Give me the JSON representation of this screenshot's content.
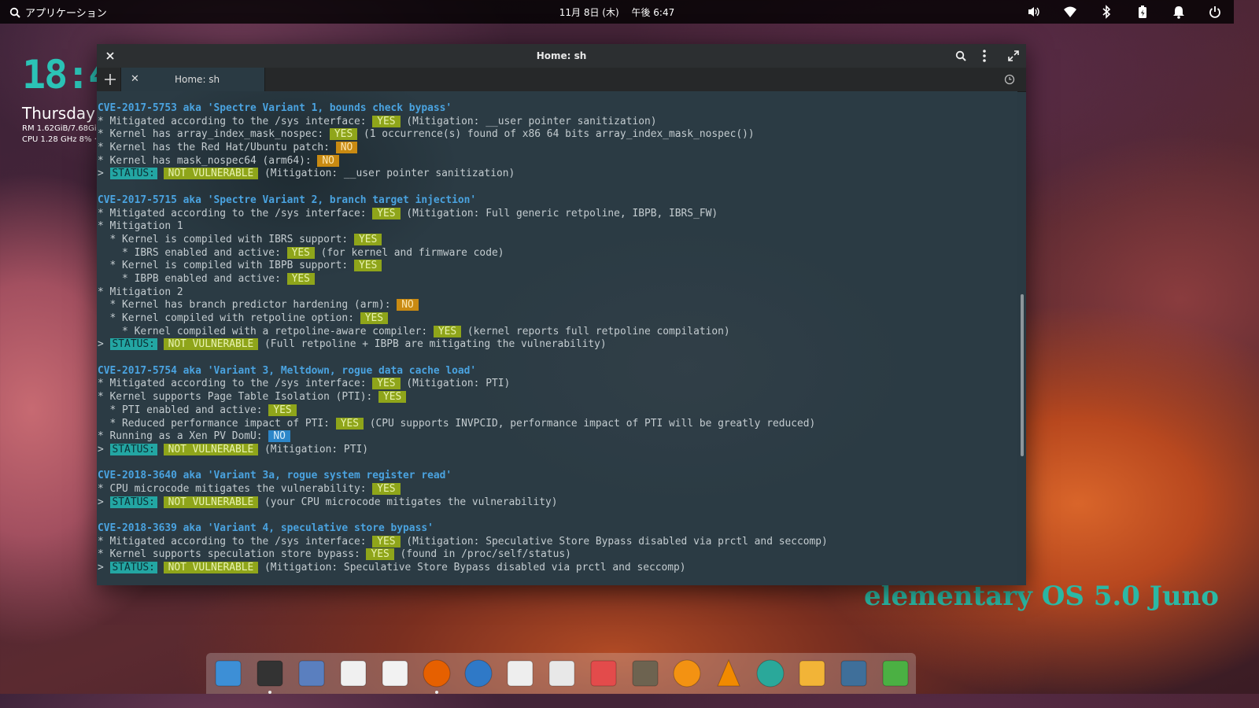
{
  "panel": {
    "applications_label": "アプリケーション",
    "clock": "11月 8日 (木)　 午後 6:47"
  },
  "conky": {
    "time": "18:4",
    "day": "Thursday",
    "ram": "RM 1.62GiB/7.68GiB",
    "cpu": "CPU 1.28 GHz 8% · W"
  },
  "brand": "elementary OS 5.0 Juno",
  "window": {
    "title": "Home: sh",
    "tab_label": "Home: sh"
  },
  "terminal": {
    "lines": [
      {
        "segments": [
          {
            "t": "CVE-2017-5753 aka 'Spectre Variant 1, bounds check bypass'",
            "c": "cve"
          }
        ]
      },
      {
        "segments": [
          {
            "t": "* Mitigated according to the /sys interface: "
          },
          {
            "t": "YES",
            "c": "b-yes"
          },
          {
            "t": " (Mitigation: __user pointer sanitization)"
          }
        ]
      },
      {
        "segments": [
          {
            "t": "* Kernel has array_index_mask_nospec: "
          },
          {
            "t": "YES",
            "c": "b-yes"
          },
          {
            "t": " (1 occurrence(s) found of x86 64 bits array_index_mask_nospec())"
          }
        ]
      },
      {
        "segments": [
          {
            "t": "* Kernel has the Red Hat/Ubuntu patch: "
          },
          {
            "t": "NO",
            "c": "b-no"
          }
        ]
      },
      {
        "segments": [
          {
            "t": "* Kernel has mask_nospec64 (arm64): "
          },
          {
            "t": "NO",
            "c": "b-no"
          }
        ]
      },
      {
        "segments": [
          {
            "t": "> "
          },
          {
            "t": "STATUS:",
            "c": "b-status"
          },
          {
            "t": " "
          },
          {
            "t": "NOT VULNERABLE",
            "c": "b-nv"
          },
          {
            "t": " (Mitigation: __user pointer sanitization)"
          }
        ]
      },
      {
        "segments": [
          {
            "t": ""
          }
        ]
      },
      {
        "segments": [
          {
            "t": "CVE-2017-5715 aka 'Spectre Variant 2, branch target injection'",
            "c": "cve"
          }
        ]
      },
      {
        "segments": [
          {
            "t": "* Mitigated according to the /sys interface: "
          },
          {
            "t": "YES",
            "c": "b-yes"
          },
          {
            "t": " (Mitigation: Full generic retpoline, IBPB, IBRS_FW)"
          }
        ]
      },
      {
        "segments": [
          {
            "t": "* Mitigation 1"
          }
        ]
      },
      {
        "segments": [
          {
            "t": "  * Kernel is compiled with IBRS support: "
          },
          {
            "t": "YES",
            "c": "b-yes"
          }
        ]
      },
      {
        "segments": [
          {
            "t": "    * IBRS enabled and active: "
          },
          {
            "t": "YES",
            "c": "b-yes"
          },
          {
            "t": " (for kernel and firmware code)"
          }
        ]
      },
      {
        "segments": [
          {
            "t": "  * Kernel is compiled with IBPB support: "
          },
          {
            "t": "YES",
            "c": "b-yes"
          }
        ]
      },
      {
        "segments": [
          {
            "t": "    * IBPB enabled and active: "
          },
          {
            "t": "YES",
            "c": "b-yes"
          }
        ]
      },
      {
        "segments": [
          {
            "t": "* Mitigation 2"
          }
        ]
      },
      {
        "segments": [
          {
            "t": "  * Kernel has branch predictor hardening (arm): "
          },
          {
            "t": "NO",
            "c": "b-no"
          }
        ]
      },
      {
        "segments": [
          {
            "t": "  * Kernel compiled with retpoline option: "
          },
          {
            "t": "YES",
            "c": "b-yes"
          }
        ]
      },
      {
        "segments": [
          {
            "t": "    * Kernel compiled with a retpoline-aware compiler: "
          },
          {
            "t": "YES",
            "c": "b-yes"
          },
          {
            "t": " (kernel reports full retpoline compilation)"
          }
        ]
      },
      {
        "segments": [
          {
            "t": "> "
          },
          {
            "t": "STATUS:",
            "c": "b-status"
          },
          {
            "t": " "
          },
          {
            "t": "NOT VULNERABLE",
            "c": "b-nv"
          },
          {
            "t": " (Full retpoline + IBPB are mitigating the vulnerability)"
          }
        ]
      },
      {
        "segments": [
          {
            "t": ""
          }
        ]
      },
      {
        "segments": [
          {
            "t": "CVE-2017-5754 aka 'Variant 3, Meltdown, rogue data cache load'",
            "c": "cve"
          }
        ]
      },
      {
        "segments": [
          {
            "t": "* Mitigated according to the /sys interface: "
          },
          {
            "t": "YES",
            "c": "b-yes"
          },
          {
            "t": " (Mitigation: PTI)"
          }
        ]
      },
      {
        "segments": [
          {
            "t": "* Kernel supports Page Table Isolation (PTI): "
          },
          {
            "t": "YES",
            "c": "b-yes"
          }
        ]
      },
      {
        "segments": [
          {
            "t": "  * PTI enabled and active: "
          },
          {
            "t": "YES",
            "c": "b-yes"
          }
        ]
      },
      {
        "segments": [
          {
            "t": "  * Reduced performance impact of PTI: "
          },
          {
            "t": "YES",
            "c": "b-yes"
          },
          {
            "t": " (CPU supports INVPCID, performance impact of PTI will be greatly reduced)"
          }
        ]
      },
      {
        "segments": [
          {
            "t": "* Running as a Xen PV DomU: "
          },
          {
            "t": "NO",
            "c": "b-no-blue"
          }
        ]
      },
      {
        "segments": [
          {
            "t": "> "
          },
          {
            "t": "STATUS:",
            "c": "b-status"
          },
          {
            "t": " "
          },
          {
            "t": "NOT VULNERABLE",
            "c": "b-nv"
          },
          {
            "t": " (Mitigation: PTI)"
          }
        ]
      },
      {
        "segments": [
          {
            "t": ""
          }
        ]
      },
      {
        "segments": [
          {
            "t": "CVE-2018-3640 aka 'Variant 3a, rogue system register read'",
            "c": "cve"
          }
        ]
      },
      {
        "segments": [
          {
            "t": "* CPU microcode mitigates the vulnerability: "
          },
          {
            "t": "YES",
            "c": "b-yes"
          }
        ]
      },
      {
        "segments": [
          {
            "t": "> "
          },
          {
            "t": "STATUS:",
            "c": "b-status"
          },
          {
            "t": " "
          },
          {
            "t": "NOT VULNERABLE",
            "c": "b-nv"
          },
          {
            "t": " (your CPU microcode mitigates the vulnerability)"
          }
        ]
      },
      {
        "segments": [
          {
            "t": ""
          }
        ]
      },
      {
        "segments": [
          {
            "t": "CVE-2018-3639 aka 'Variant 4, speculative store bypass'",
            "c": "cve"
          }
        ]
      },
      {
        "segments": [
          {
            "t": "* Mitigated according to the /sys interface: "
          },
          {
            "t": "YES",
            "c": "b-yes"
          },
          {
            "t": " (Mitigation: Speculative Store Bypass disabled via prctl and seccomp)"
          }
        ]
      },
      {
        "segments": [
          {
            "t": "* Kernel supports speculation store bypass: "
          },
          {
            "t": "YES",
            "c": "b-yes"
          },
          {
            "t": " (found in /proc/self/status)"
          }
        ]
      },
      {
        "segments": [
          {
            "t": "> "
          },
          {
            "t": "STATUS:",
            "c": "b-status"
          },
          {
            "t": " "
          },
          {
            "t": "NOT VULNERABLE",
            "c": "b-nv"
          },
          {
            "t": " (Mitigation: Speculative Store Bypass disabled via prctl and seccomp)"
          }
        ]
      }
    ]
  },
  "dock": {
    "items": [
      {
        "name": "multitasking-view-icon",
        "color": "#3d8fd6"
      },
      {
        "name": "terminal-icon",
        "color": "#333333"
      },
      {
        "name": "files-icon",
        "color": "#5a7fbf"
      },
      {
        "name": "text-editor-icon",
        "color": "#f0f0f0"
      },
      {
        "name": "code-editor-icon",
        "color": "#f2f2f2"
      },
      {
        "name": "firefox-icon",
        "color": "#e66000"
      },
      {
        "name": "thunderbird-icon",
        "color": "#2f79c7"
      },
      {
        "name": "document-icon",
        "color": "#eeeeee"
      },
      {
        "name": "calendar-icon",
        "color": "#e8e8e8"
      },
      {
        "name": "photos-icon",
        "color": "#e34b4b"
      },
      {
        "name": "gimp-icon",
        "color": "#6d6350"
      },
      {
        "name": "music-icon",
        "color": "#f39212"
      },
      {
        "name": "vlc-icon",
        "color": "#f18a00"
      },
      {
        "name": "settings-icon",
        "color": "#2aa89a"
      },
      {
        "name": "downloader-icon",
        "color": "#f2b437"
      },
      {
        "name": "screenshot-icon",
        "color": "#3f6f9a"
      },
      {
        "name": "trash-icon",
        "color": "#4bb043"
      }
    ]
  }
}
